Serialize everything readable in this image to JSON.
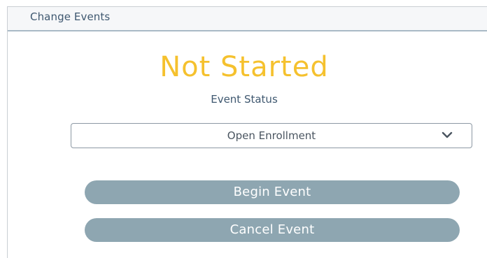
{
  "panel": {
    "title": "Change Events"
  },
  "status": {
    "value": "Not Started",
    "label": "Event Status"
  },
  "event_select": {
    "selected": "Open Enrollment",
    "icon": "chevron-down-icon"
  },
  "actions": {
    "begin_label": "Begin Event",
    "cancel_label": "Cancel Event"
  },
  "colors": {
    "status_accent": "#f5c12e",
    "button_bg": "#8ea6b1",
    "title_text": "#3f5870"
  }
}
